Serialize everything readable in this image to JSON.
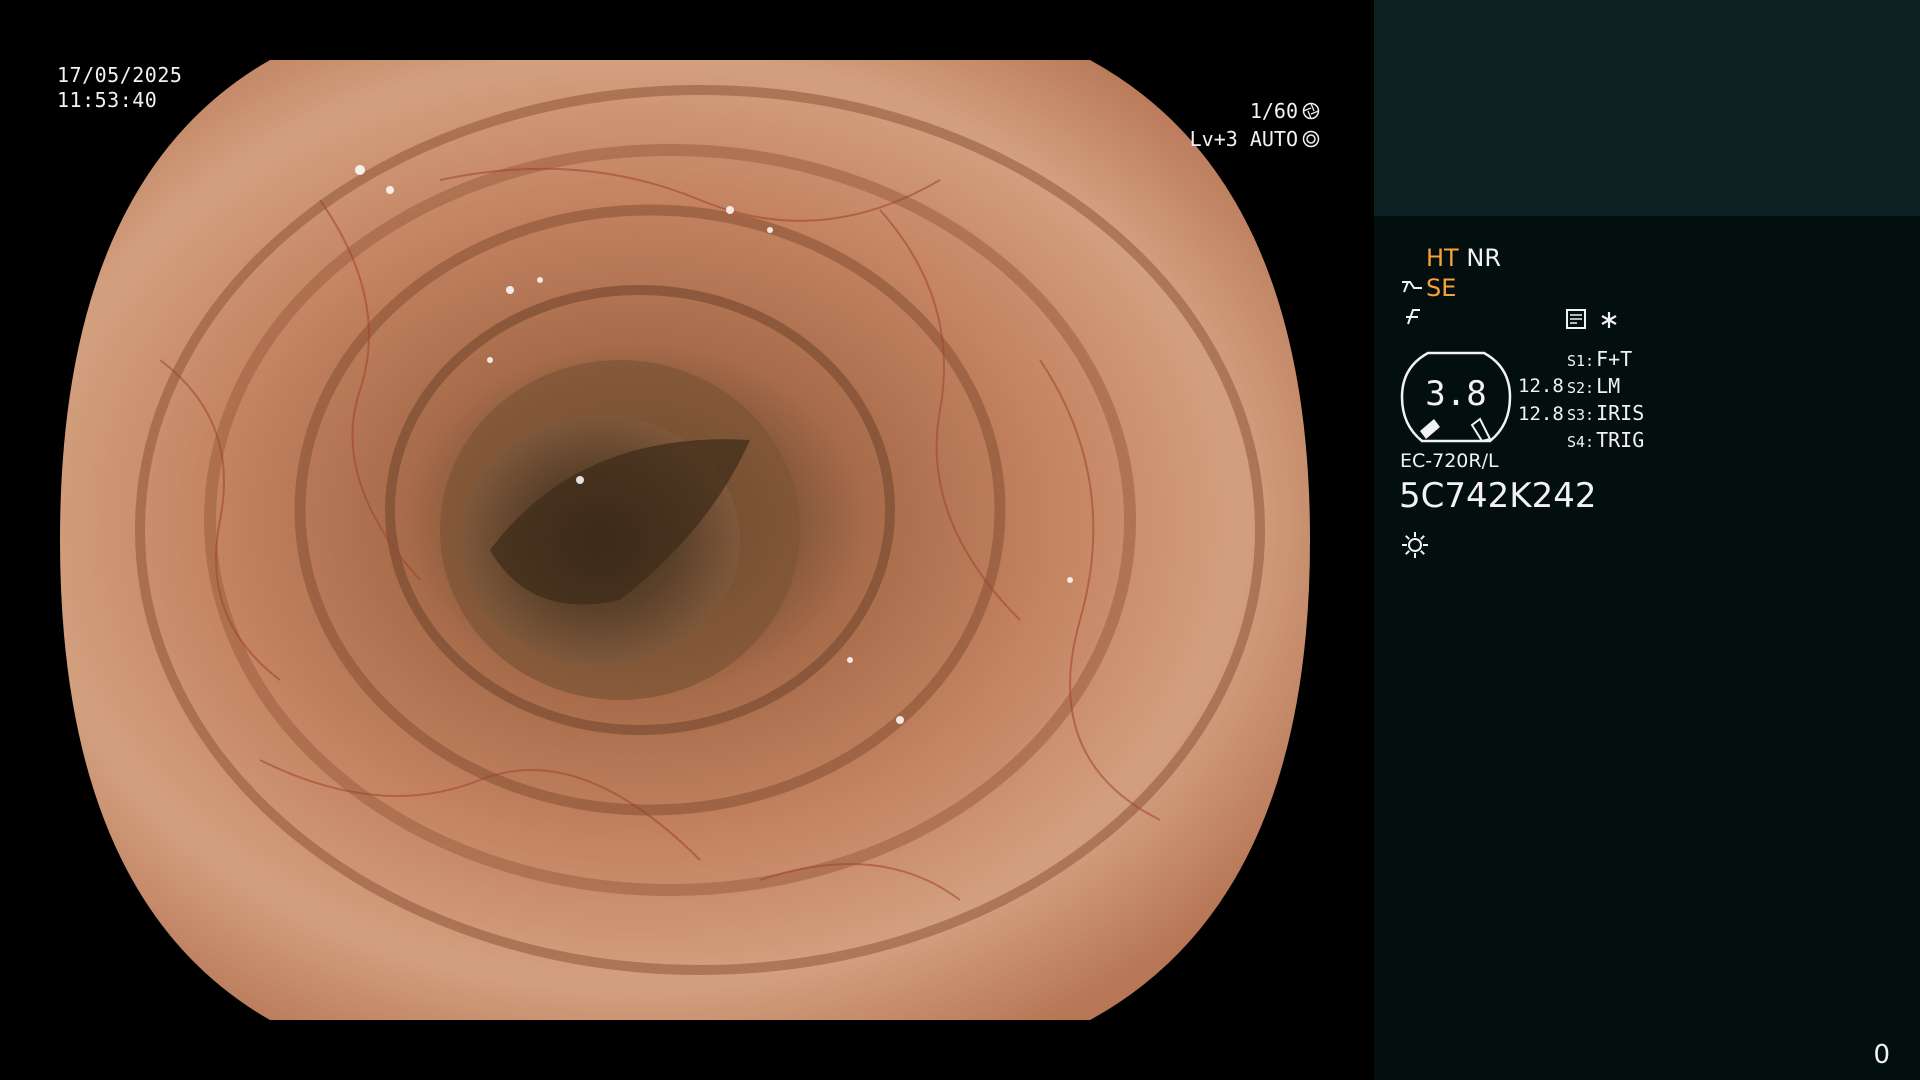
{
  "overlay": {
    "date": "17/05/2025",
    "time": "11:53:40",
    "shutter": "1/60",
    "shutter_icon": "aperture-icon",
    "light_level": "Lv+3 AUTO",
    "light_level_icon": "auto-iris-icon"
  },
  "panel": {
    "mode_ht": "HT",
    "mode_nr": "NR",
    "mode_se": "SE",
    "mode_se_icon": "scope-tip-icon",
    "mode3_icon": "structure-enhance-icon",
    "record_icon": "record-icon",
    "star_icon": "asterisk-icon",
    "gauge_value": "3.8",
    "gauge_num_1": "12.8",
    "gauge_num_2": "12.8",
    "switches": [
      {
        "key": "S1:",
        "value": "F+T"
      },
      {
        "key": "S2:",
        "value": "LM"
      },
      {
        "key": "S3:",
        "value": "IRIS"
      },
      {
        "key": "S4:",
        "value": "TRIG"
      }
    ],
    "scope_model": "EC-720R/L",
    "scope_serial": "5C742K242",
    "light_icon": "light-source-icon",
    "corner_count": "0"
  },
  "colors": {
    "panel_top": "#0c2222",
    "panel_bottom": "#030f0e",
    "accent_orange": "#f6a23a",
    "tissue": "#c98a63"
  }
}
